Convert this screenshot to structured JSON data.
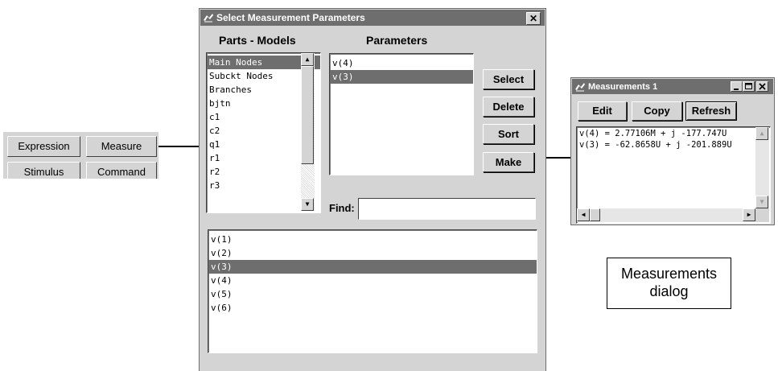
{
  "toolbar": {
    "expression": "Expression",
    "measure": "Measure",
    "stimulus": "Stimulus",
    "command": "Command"
  },
  "select_dialog": {
    "title": "Select Measurement Parameters",
    "close_glyph": "✕",
    "parts_header": "Parts - Models",
    "parameters_header": "Parameters",
    "parts_list": [
      "Main Nodes",
      "Subckt Nodes",
      "Branches",
      "bjtn",
      "c1",
      "c2",
      "q1",
      "r1",
      "r2",
      "r3"
    ],
    "parameters_list": [
      "v(4)",
      "v(3)"
    ],
    "buttons": {
      "select": "Select",
      "delete": "Delete",
      "sort": "Sort",
      "make": "Make"
    },
    "find_label": "Find:",
    "find_value": "",
    "nodes_list": [
      "v(1)",
      "v(2)",
      "v(3)",
      "v(4)",
      "v(5)",
      "v(6)"
    ]
  },
  "measurements": {
    "title": "Measurements 1",
    "edit": "Edit",
    "copy": "Copy",
    "refresh": "Refresh",
    "lines": [
      "v(4) = 2.77106M + j -177.747U",
      "v(3) = -62.8658U + j -201.889U"
    ]
  },
  "caption": {
    "line1": "Measurements",
    "line2": "dialog"
  }
}
